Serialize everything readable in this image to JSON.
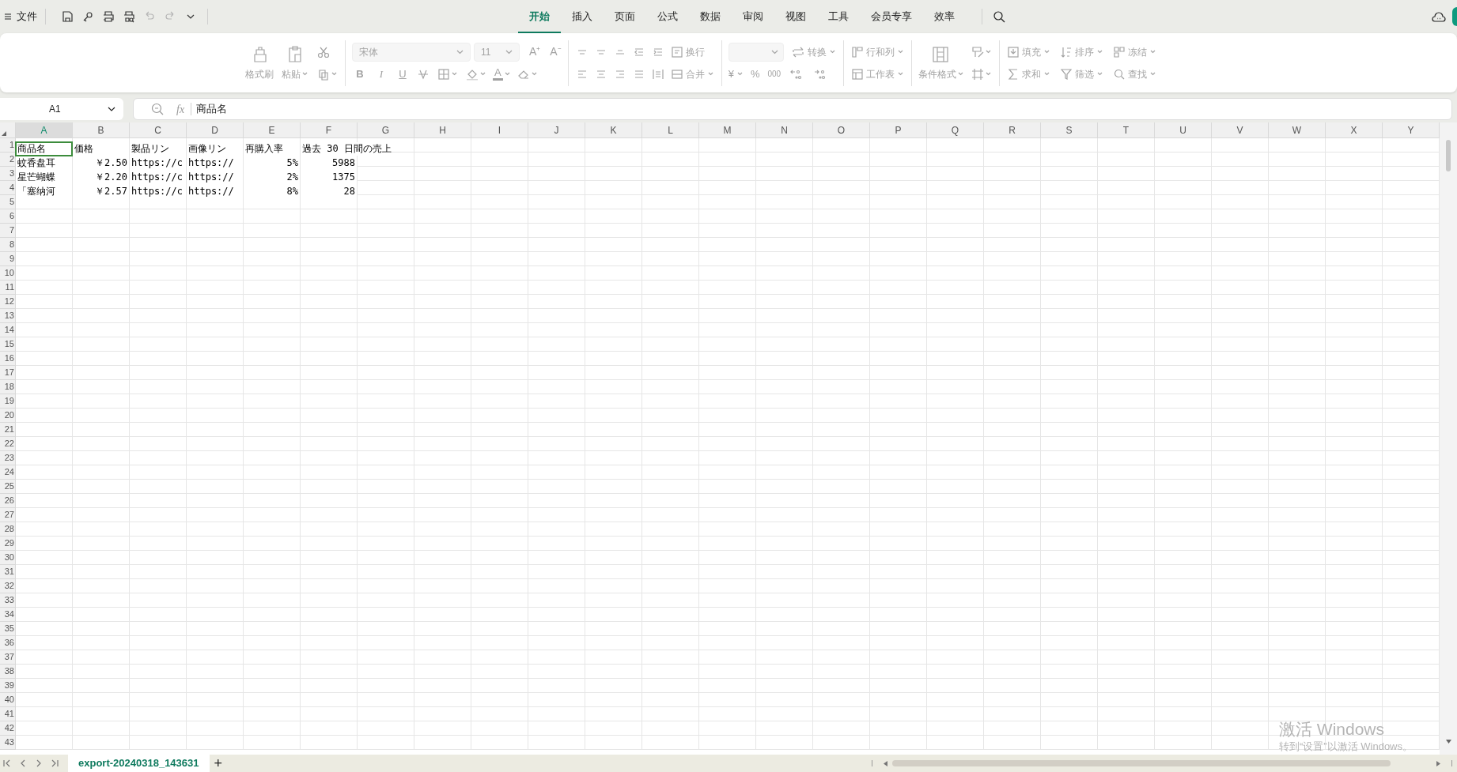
{
  "top_bar": {
    "file_menu": "文件",
    "tabs": [
      {
        "label": "开始",
        "selected": true
      },
      {
        "label": "插入",
        "selected": false
      },
      {
        "label": "页面",
        "selected": false
      },
      {
        "label": "公式",
        "selected": false
      },
      {
        "label": "数据",
        "selected": false
      },
      {
        "label": "审阅",
        "selected": false
      },
      {
        "label": "视图",
        "selected": false
      },
      {
        "label": "工具",
        "selected": false
      },
      {
        "label": "会员专享",
        "selected": false
      },
      {
        "label": "效率",
        "selected": false
      }
    ]
  },
  "ribbon": {
    "disabled": true,
    "format_painter": "格式刷",
    "paste": "粘贴",
    "font_name": "宋体",
    "font_size": "11",
    "increase_font": "A⁺",
    "decrease_font": "A⁻",
    "bold": "B",
    "italic": "I",
    "underline": "U",
    "font_color": "A",
    "wrap": "换行",
    "merge": "合并",
    "convert": "转换",
    "currency": "¥",
    "percent": "%",
    "thousands": "000",
    "rows_columns": "行和列",
    "worksheet": "工作表",
    "conditional_format": "条件格式",
    "fill": "填充",
    "sort": "排序",
    "freeze": "冻结",
    "sum": "求和",
    "filter": "筛选",
    "find": "查找"
  },
  "formula_bar": {
    "cell_ref": "A1",
    "fx": "fx",
    "value": "商品名"
  },
  "sheet": {
    "columns": [
      {
        "label": "A",
        "selected": true
      },
      {
        "label": "B",
        "selected": false
      },
      {
        "label": "C",
        "selected": false
      },
      {
        "label": "D",
        "selected": false
      },
      {
        "label": "E",
        "selected": false
      },
      {
        "label": "F",
        "selected": false
      },
      {
        "label": "G",
        "selected": false
      },
      {
        "label": "H",
        "selected": false
      },
      {
        "label": "I",
        "selected": false
      },
      {
        "label": "J",
        "selected": false
      },
      {
        "label": "K",
        "selected": false
      },
      {
        "label": "L",
        "selected": false
      },
      {
        "label": "M",
        "selected": false
      },
      {
        "label": "N",
        "selected": false
      },
      {
        "label": "O",
        "selected": false
      },
      {
        "label": "P",
        "selected": false
      },
      {
        "label": "Q",
        "selected": false
      },
      {
        "label": "R",
        "selected": false
      },
      {
        "label": "S",
        "selected": false
      },
      {
        "label": "T",
        "selected": false
      },
      {
        "label": "U",
        "selected": false
      },
      {
        "label": "V",
        "selected": false
      },
      {
        "label": "W",
        "selected": false
      },
      {
        "label": "X",
        "selected": false
      },
      {
        "label": "Y",
        "selected": false
      }
    ],
    "rows": [
      {
        "label": "1",
        "cells": [
          {
            "text": "商品名",
            "kind": "text",
            "selected": true
          },
          {
            "text": "価格",
            "kind": "text",
            "selected": false
          },
          {
            "text": "製品リン",
            "kind": "text",
            "selected": false
          },
          {
            "text": "画像リン",
            "kind": "text",
            "selected": false
          },
          {
            "text": "再購入率",
            "kind": "text",
            "selected": false
          },
          {
            "text": "過去 30 日間の売上",
            "kind": "text",
            "selected": false
          }
        ]
      },
      {
        "label": "2",
        "cells": [
          {
            "text": "蚊香盘耳",
            "kind": "text",
            "selected": false
          },
          {
            "text": "￥2.50",
            "kind": "number",
            "selected": false
          },
          {
            "text": "https://c",
            "kind": "text",
            "selected": false
          },
          {
            "text": "https://",
            "kind": "text",
            "selected": false
          },
          {
            "text": "5%",
            "kind": "number",
            "selected": false
          },
          {
            "text": "5988",
            "kind": "number",
            "selected": false
          }
        ]
      },
      {
        "label": "3",
        "cells": [
          {
            "text": "星芒蝴蝶",
            "kind": "text",
            "selected": false
          },
          {
            "text": "￥2.20",
            "kind": "number",
            "selected": false
          },
          {
            "text": "https://c",
            "kind": "text",
            "selected": false
          },
          {
            "text": "https://",
            "kind": "text",
            "selected": false
          },
          {
            "text": "2%",
            "kind": "number",
            "selected": false
          },
          {
            "text": "1375",
            "kind": "number",
            "selected": false
          }
        ]
      },
      {
        "label": "4",
        "cells": [
          {
            "text": "「塞纳河",
            "kind": "text",
            "selected": false
          },
          {
            "text": "￥2.57",
            "kind": "number",
            "selected": false
          },
          {
            "text": "https://c",
            "kind": "text",
            "selected": false
          },
          {
            "text": "https://",
            "kind": "text",
            "selected": false
          },
          {
            "text": "8%",
            "kind": "number",
            "selected": false
          },
          {
            "text": "28",
            "kind": "number",
            "selected": false
          }
        ]
      },
      {
        "label": "5"
      },
      {
        "label": "6"
      },
      {
        "label": "7"
      },
      {
        "label": "8"
      },
      {
        "label": "9"
      },
      {
        "label": "10"
      },
      {
        "label": "11"
      },
      {
        "label": "12"
      },
      {
        "label": "13"
      },
      {
        "label": "14"
      },
      {
        "label": "15"
      },
      {
        "label": "16"
      },
      {
        "label": "17"
      },
      {
        "label": "18"
      },
      {
        "label": "19"
      },
      {
        "label": "20"
      },
      {
        "label": "21"
      },
      {
        "label": "22"
      },
      {
        "label": "23"
      },
      {
        "label": "24"
      },
      {
        "label": "25"
      },
      {
        "label": "26"
      },
      {
        "label": "27"
      },
      {
        "label": "28"
      },
      {
        "label": "29"
      },
      {
        "label": "30"
      },
      {
        "label": "31"
      },
      {
        "label": "32"
      },
      {
        "label": "33"
      },
      {
        "label": "34"
      },
      {
        "label": "35"
      },
      {
        "label": "36"
      },
      {
        "label": "37"
      },
      {
        "label": "38"
      },
      {
        "label": "39"
      },
      {
        "label": "40"
      },
      {
        "label": "41"
      },
      {
        "label": "42"
      },
      {
        "label": "43"
      }
    ]
  },
  "sheet_tabs": [
    {
      "label": "export-20240318_143631",
      "selected": true
    }
  ],
  "add_sheet": "+",
  "activation_notice": {
    "title": "激活 Windows",
    "text": "转到“设置”以激活 Windows。"
  }
}
